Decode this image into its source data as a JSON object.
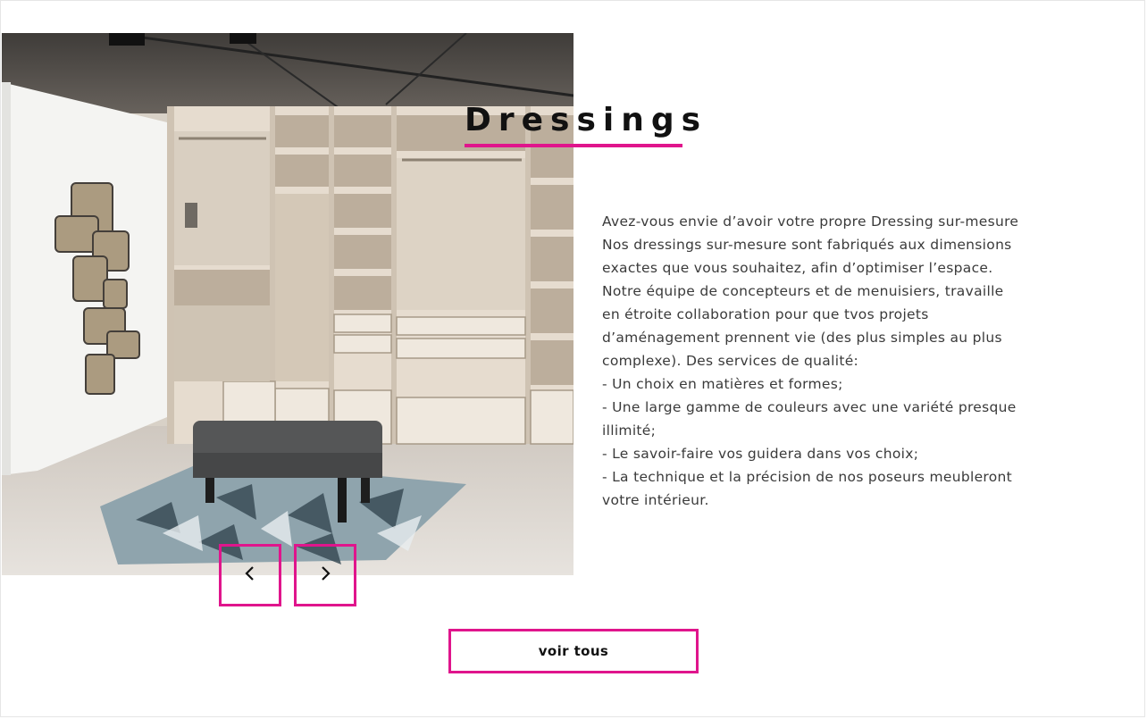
{
  "section": {
    "title": "Dressings",
    "paragraph_lines": [
      "Avez-vous envie d’avoir votre propre Dressing sur-mesure",
      "Nos dressings sur-mesure sont fabriqués aux dimensions",
      "exactes que vous souhaitez, afin d’optimiser l’espace.",
      "Notre équipe de concepteurs et de menuisiers, travaille",
      "en étroite collaboration pour que tvos projets",
      "d’aménagement prennent vie (des plus simples au plus",
      "complexe). Des services de qualité:",
      "- Un choix en matières et formes;",
      "- Une large gamme de couleurs avec une variété presque",
      "illimité;",
      "- Le savoir-faire vos guidera dans vos choix;",
      "- La technique et la précision de nos poseurs meubleront",
      "votre intérieur."
    ]
  },
  "slider": {
    "prev_icon": "chevron-left-icon",
    "next_icon": "chevron-right-icon"
  },
  "cta": {
    "voir_tous_label": "voir tous"
  },
  "colors": {
    "accent": "#e0158c",
    "text": "#3a3a3a",
    "title": "#111111"
  }
}
